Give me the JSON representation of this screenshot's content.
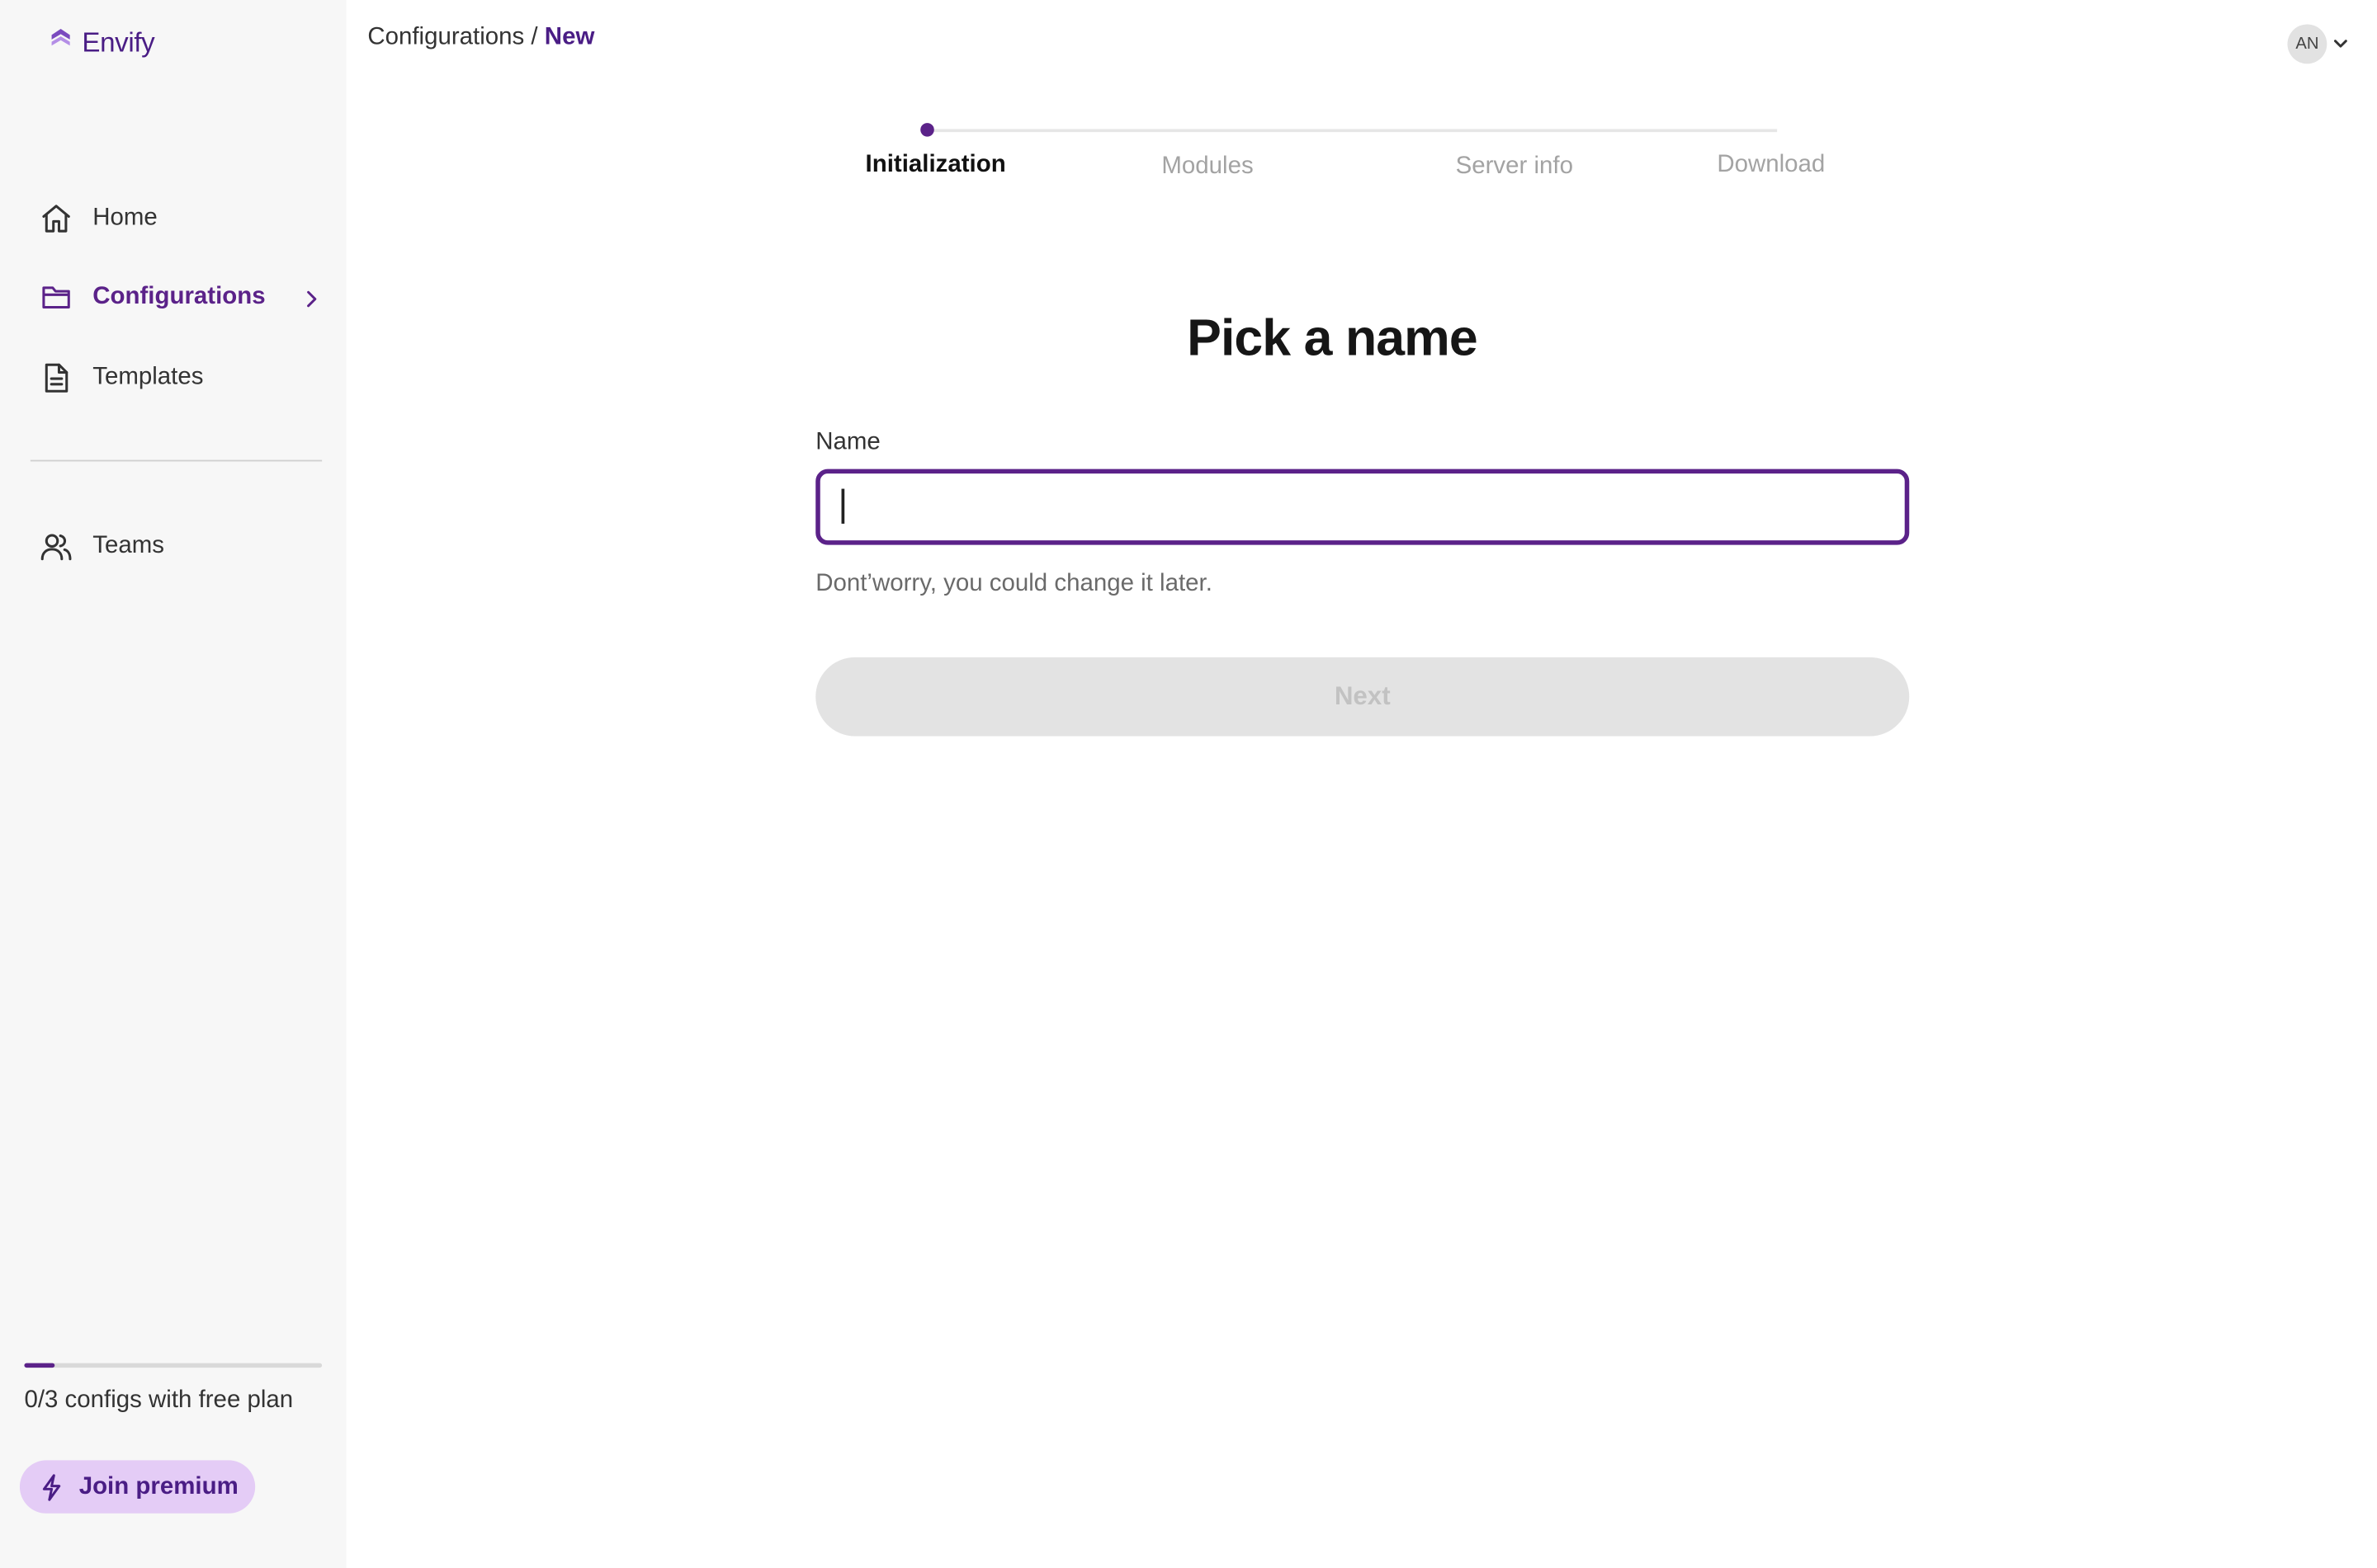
{
  "app": {
    "name": "Envify",
    "brand_color": "#4a1d85",
    "accent_color": "#5b2289"
  },
  "sidebar": {
    "items": [
      {
        "label": "Home",
        "icon": "home-icon",
        "active": false
      },
      {
        "label": "Configurations",
        "icon": "folder-icon",
        "active": true,
        "has_chevron": true
      },
      {
        "label": "Templates",
        "icon": "document-icon",
        "active": false
      },
      {
        "label": "Teams",
        "icon": "users-icon",
        "active": false
      }
    ],
    "plan": {
      "text": "0/3 configs with free plan",
      "used": 0,
      "total": 3,
      "progress_fraction": 0.1
    },
    "premium_button": {
      "label": "Join premium",
      "icon": "bolt-icon"
    }
  },
  "header": {
    "breadcrumb": {
      "parent": "Configurations",
      "separator": "/",
      "current": "New"
    },
    "user": {
      "initials": "AN",
      "icon": "chevron-down-icon"
    }
  },
  "stepper": {
    "steps": [
      {
        "label": "Initialization",
        "active": true
      },
      {
        "label": "Modules",
        "active": false
      },
      {
        "label": "Server info",
        "active": false
      },
      {
        "label": "Download",
        "active": false
      }
    ],
    "current_step": 1
  },
  "form": {
    "title": "Pick a name",
    "name_label": "Name",
    "name_value": "",
    "hint": "Dont’worry, you could change it later.",
    "next_label": "Next",
    "next_disabled": true
  }
}
